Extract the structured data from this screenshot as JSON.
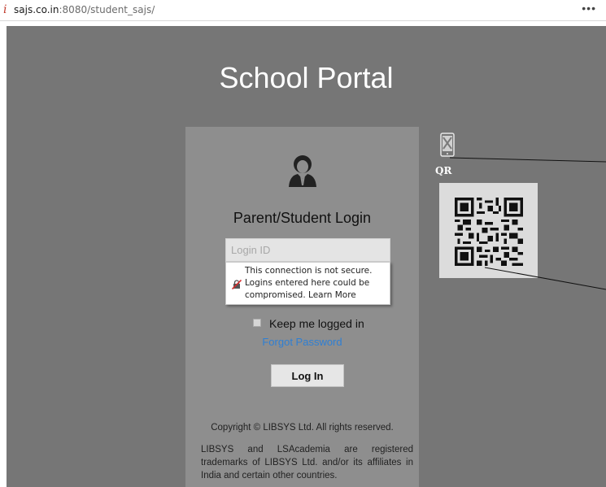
{
  "browser": {
    "url_host": "sajs.co.in",
    "url_path": ":8080/student_sajs/",
    "menu_icon": "more-dots-icon",
    "info_icon": "site-info-icon"
  },
  "page": {
    "title": "School Portal"
  },
  "login": {
    "avatar_icon": "user-avatar-icon",
    "heading": "Parent/Student Login",
    "login_id_placeholder": "Login ID",
    "insecure_warning": {
      "line1": "This connection is not secure.",
      "line2": "Logins entered here could be",
      "line3_prefix": "compromised.",
      "learn_more": "Learn More",
      "icon": "insecure-lock-icon"
    },
    "keep_logged_in": "Keep me logged in",
    "forgot_password": "Forgot Password",
    "login_button": "Log In",
    "copyright": "Copyright © LIBSYS Ltd. All rights reserved.",
    "trademark": "LIBSYS and LSAcademia are registered trademarks of LIBSYS Ltd. and/or its affiliates in India and certain other countries."
  },
  "qr": {
    "label": "QR",
    "phone_icon": "phone-qr-icon"
  },
  "colors": {
    "page_background": "#767676",
    "panel_background": "#8e8e8e",
    "link": "#2f7fd3",
    "title": "#ffffff"
  }
}
